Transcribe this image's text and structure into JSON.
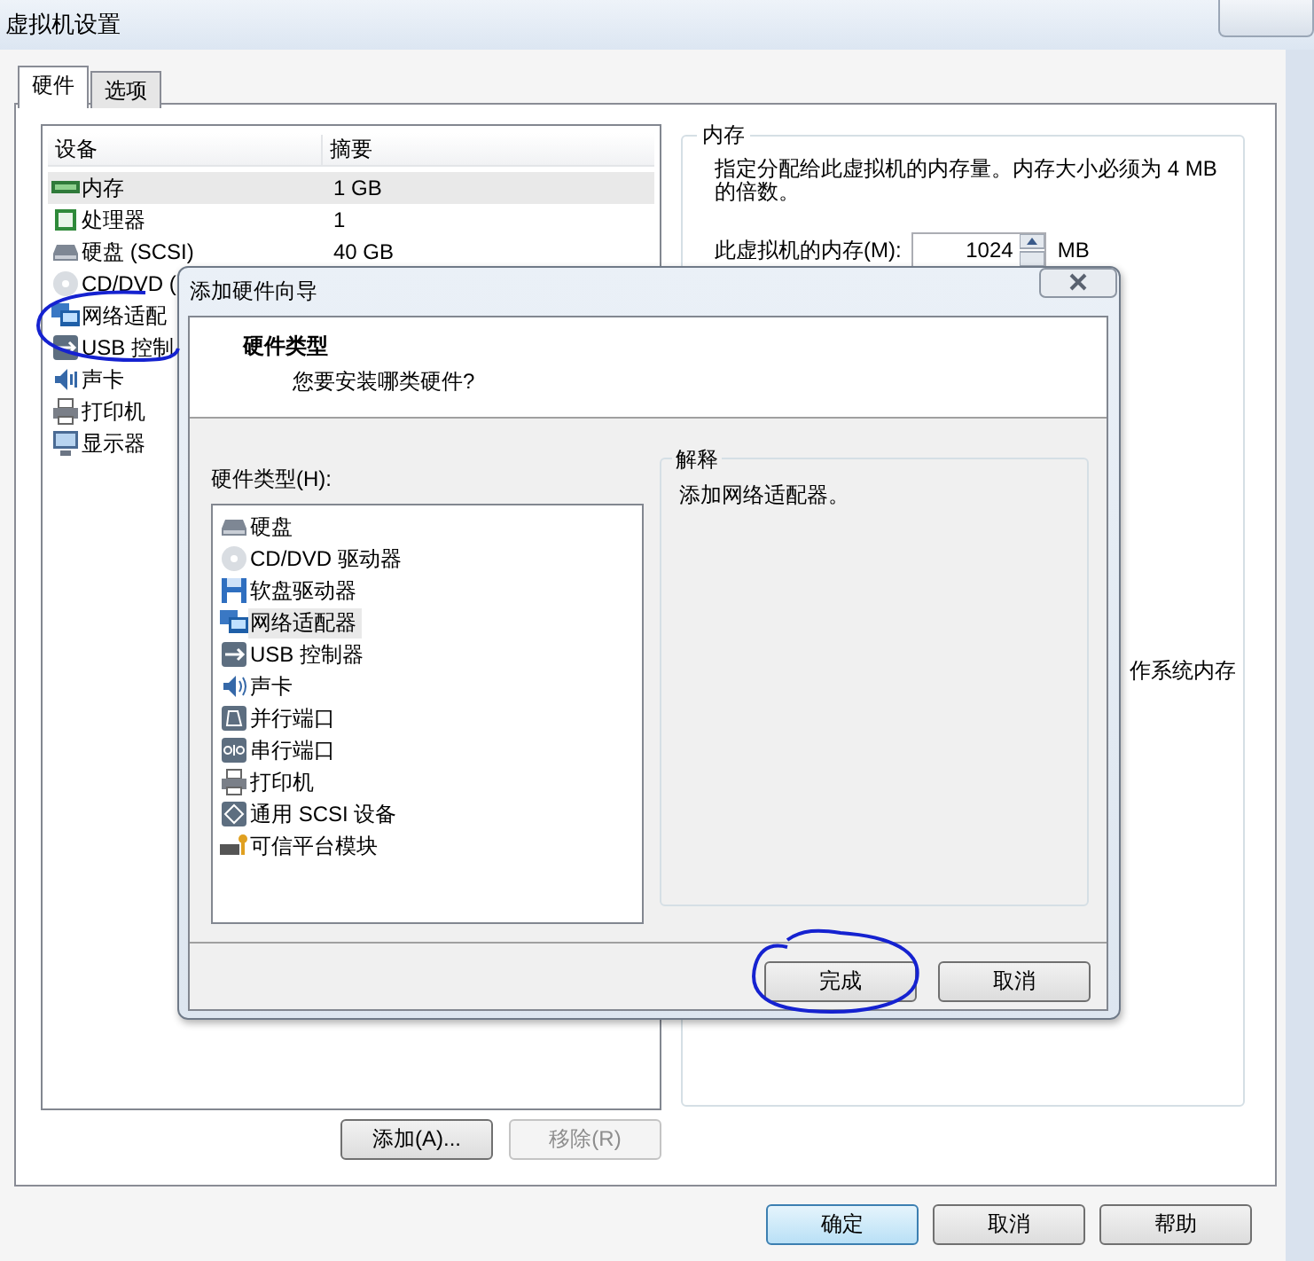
{
  "window": {
    "title": "虚拟机设置"
  },
  "tabs": [
    {
      "label": "硬件",
      "selected": true
    },
    {
      "label": "选项",
      "selected": false
    }
  ],
  "device_table": {
    "columns": [
      "设备",
      "摘要"
    ],
    "rows": [
      {
        "kind": "memory",
        "device": "内存",
        "summary": "1 GB",
        "selected": true
      },
      {
        "kind": "cpu",
        "device": "处理器",
        "summary": "1",
        "selected": false
      },
      {
        "kind": "disk",
        "device": "硬盘 (SCSI)",
        "summary": "40 GB",
        "selected": false
      },
      {
        "kind": "cdrom",
        "device": "CD/DVD (",
        "selected": false
      },
      {
        "kind": "network",
        "device": "网络适配",
        "selected": false
      },
      {
        "kind": "usb",
        "device": "USB 控制",
        "selected": false
      },
      {
        "kind": "sound",
        "device": "声卡",
        "selected": false
      },
      {
        "kind": "printer",
        "device": "打印机",
        "selected": false
      },
      {
        "kind": "display",
        "device": "显示器",
        "selected": false
      }
    ]
  },
  "device_buttons": [
    {
      "label": "添加(A)...",
      "disabled": false
    },
    {
      "label": "移除(R)",
      "disabled": true
    }
  ],
  "memory": {
    "title": "内存",
    "description": "指定分配给此虚拟机的内存量。内存大小必须为 4 MB 的倍数。",
    "field_label": "此虚拟机的内存(M):",
    "value": "1024",
    "unit": "MB",
    "partial_text": "作系统内存"
  },
  "footer_buttons": [
    {
      "label": "确定",
      "default": true
    },
    {
      "label": "取消",
      "default": false
    },
    {
      "label": "帮助",
      "default": false
    }
  ],
  "dialog": {
    "title": "添加硬件向导",
    "heading": "硬件类型",
    "subheading": "您要安装哪类硬件?",
    "list_label": "硬件类型(H):",
    "hardware_types": [
      {
        "kind": "disk",
        "label": "硬盘",
        "selected": false
      },
      {
        "kind": "cdrom",
        "label": "CD/DVD 驱动器",
        "selected": false
      },
      {
        "kind": "floppy",
        "label": "软盘驱动器",
        "selected": false
      },
      {
        "kind": "network",
        "label": "网络适配器",
        "selected": true
      },
      {
        "kind": "usb",
        "label": "USB 控制器",
        "selected": false
      },
      {
        "kind": "sound",
        "label": "声卡",
        "selected": false
      },
      {
        "kind": "parallel",
        "label": "并行端口",
        "selected": false
      },
      {
        "kind": "serial",
        "label": "串行端口",
        "selected": false
      },
      {
        "kind": "printer",
        "label": "打印机",
        "selected": false
      },
      {
        "kind": "scsi",
        "label": "通用 SCSI 设备",
        "selected": false
      },
      {
        "kind": "tpm",
        "label": "可信平台模块",
        "selected": false
      }
    ],
    "explanation": {
      "title": "解释",
      "text": "添加网络适配器。"
    },
    "buttons": [
      {
        "label": "完成",
        "default": false
      },
      {
        "label": "取消",
        "default": false
      }
    ]
  }
}
